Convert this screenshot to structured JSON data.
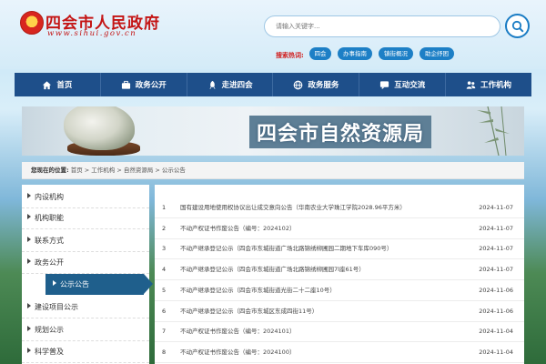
{
  "header": {
    "site_title": "四会市人民政府",
    "site_domain": "www.sihui.gov.cn",
    "search_placeholder": "请输入关键字...",
    "hot_label": "搜索热词:",
    "hot_tags": [
      "四会",
      "办事指南",
      "镇街概况",
      "助企纾困"
    ]
  },
  "nav": {
    "items": [
      {
        "label": "首页",
        "icon": "home-icon"
      },
      {
        "label": "政务公开",
        "icon": "briefcase-icon"
      },
      {
        "label": "走进四会",
        "icon": "rocket-icon"
      },
      {
        "label": "政务服务",
        "icon": "globe-icon"
      },
      {
        "label": "互动交流",
        "icon": "chat-icon"
      },
      {
        "label": "工作机构",
        "icon": "people-icon"
      }
    ]
  },
  "banner": {
    "title": "四会市自然资源局"
  },
  "breadcrumb": {
    "label": "您现在的位置:",
    "path": "首页 > 工作机构 > 自然资源局 > 公示公告"
  },
  "sidebar": {
    "items": [
      {
        "label": "内设机构",
        "active": false
      },
      {
        "label": "机构职能",
        "active": false
      },
      {
        "label": "联系方式",
        "active": false
      },
      {
        "label": "政务公开",
        "active": false
      },
      {
        "label": "公示公告",
        "active": true
      },
      {
        "label": "建设项目公示",
        "active": false
      },
      {
        "label": "规划公示",
        "active": false
      },
      {
        "label": "科学普及",
        "active": false
      }
    ]
  },
  "list": {
    "rows": [
      {
        "num": "1",
        "title": "国有建设用地使用权协议出让成交意向公告（华南农业大学珠江学院2028.96平方米）",
        "date": "2024-11-07"
      },
      {
        "num": "2",
        "title": "不动产权证书作废公告（编号：2024102）",
        "date": "2024-11-07"
      },
      {
        "num": "3",
        "title": "不动产继承登记公示（四会市东城街道广场北路锦绣柳圃园二期地下车库090号）",
        "date": "2024-11-07"
      },
      {
        "num": "4",
        "title": "不动产继承登记公示（四会市东城街道广场北路锦绣柳圃园7l座61号）",
        "date": "2024-11-07"
      },
      {
        "num": "5",
        "title": "不动产继承登记公示（四会市东城街道光街二十二座10号）",
        "date": "2024-11-06"
      },
      {
        "num": "6",
        "title": "不动产继承登记公示（四会市东城区东成四街11号）",
        "date": "2024-11-06"
      },
      {
        "num": "7",
        "title": "不动产权证书作废公告（编号：2024101）",
        "date": "2024-11-04"
      },
      {
        "num": "8",
        "title": "不动产权证书作废公告（编号：2024100）",
        "date": "2024-11-04"
      }
    ]
  },
  "colors": {
    "nav_bg": "#1e4f8a",
    "title_red": "#c41414",
    "hot_tag": "#1d7fc6",
    "active_side": "#1f5f8c"
  }
}
